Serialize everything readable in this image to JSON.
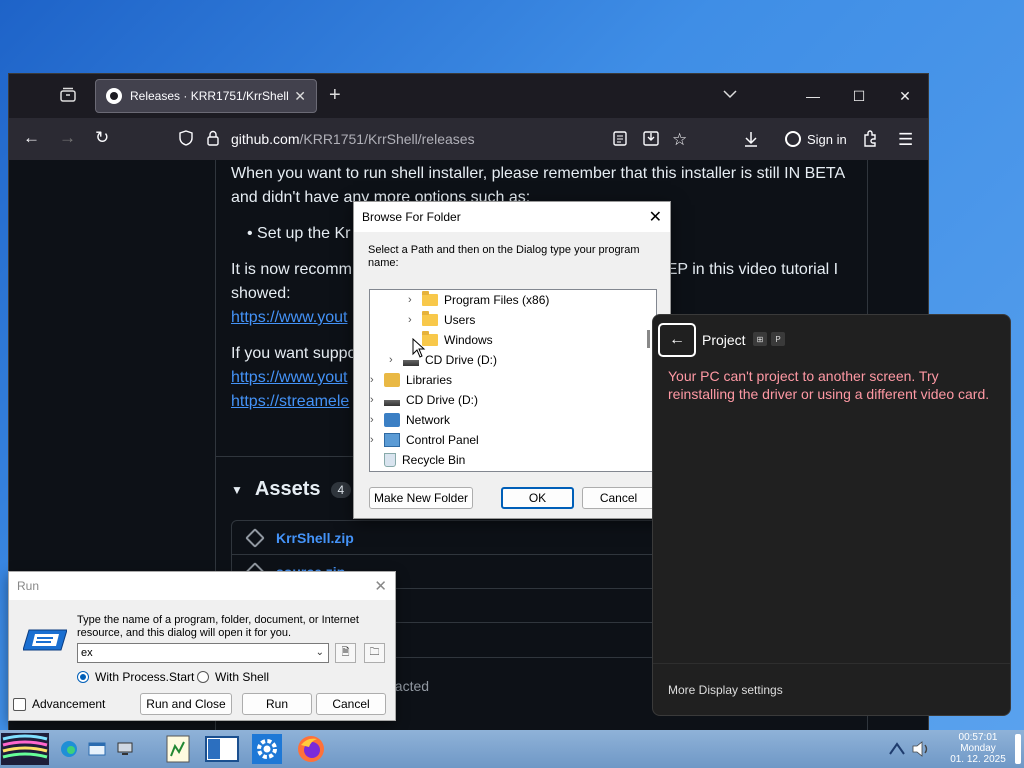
{
  "firefox": {
    "tab_title": "Releases · KRR1751/KrrShell",
    "tab_close": "✕",
    "new_tab": "+",
    "url_host": "github.com",
    "url_path": "/KRR1751/KrrShell/releases",
    "sign_in": "Sign in",
    "window_controls": [
      "—",
      "☐",
      "✕"
    ]
  },
  "github": {
    "para1": "When you want to run shell installer, please remember that this installer is still IN BETA and didn't have any more options such as:",
    "bullet1": "Set up the Kr",
    "para2_start": "It is now recomm",
    "para2_end": "TEP in this video tutorial I",
    "showed": "showed:",
    "link1": "https://www.yout",
    "para3_start": "If you want suppo",
    "link2": "https://www.yout",
    "link3": "https://streamele",
    "assets_title": "Assets",
    "assets_count": "4",
    "assets": [
      "KrrShell.zip",
      "source.zip"
    ],
    "reacted": "eacted"
  },
  "browse_folder": {
    "title": "Browse For Folder",
    "description": "Select a Path and then on the Dialog type your program name:",
    "tree": [
      {
        "label": "Program Files (x86)",
        "icon": "folder-icon"
      },
      {
        "label": "Users",
        "icon": "folder-icon"
      },
      {
        "label": "Windows",
        "icon": "folder-icon"
      },
      {
        "label": "CD Drive (D:)",
        "icon": "cd-drive-icon"
      },
      {
        "label": "Libraries",
        "icon": "libraries-icon"
      },
      {
        "label": "CD Drive (D:)",
        "icon": "cd-drive-icon"
      },
      {
        "label": "Network",
        "icon": "network-icon"
      },
      {
        "label": "Control Panel",
        "icon": "control-panel-icon"
      },
      {
        "label": "Recycle Bin",
        "icon": "recycle-bin-icon"
      }
    ],
    "make_new_folder": "Make New Folder",
    "ok": "OK",
    "cancel": "Cancel"
  },
  "project": {
    "title": "Project",
    "keys": [
      "⊞",
      "P"
    ],
    "error": "Your PC can't project to another screen. Try reinstalling the driver or using a different video card.",
    "footer": "More Display settings",
    "error_color": "#ff99a4"
  },
  "run": {
    "title": "Run",
    "description": "Type the name of a program, folder, document, or Internet resource, and this dialog will open it for you.",
    "input_value": "ex",
    "radio1": "With Process.Start",
    "radio2": "With Shell",
    "advancement": "Advancement",
    "run_and_close": "Run and Close",
    "run": "Run",
    "cancel": "Cancel"
  },
  "taskbar": {
    "time": "00:57:01",
    "day": "Monday",
    "date": "01. 12. 2025"
  }
}
